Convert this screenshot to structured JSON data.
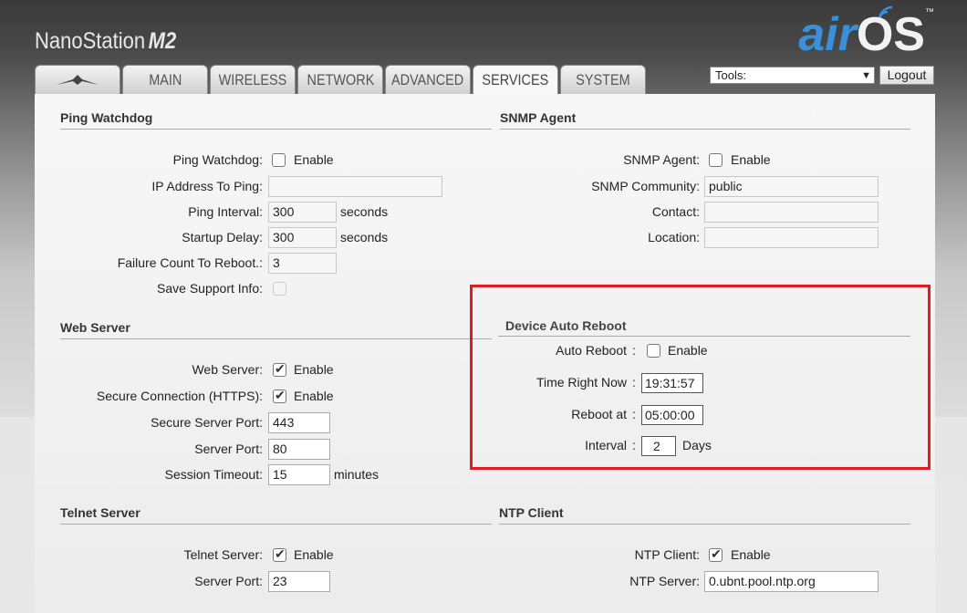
{
  "header": {
    "brand": "NanoStation",
    "brand_model": "M2",
    "logo_air": "air",
    "logo_os": "OS",
    "logo_tm": "™"
  },
  "tabs": [
    {
      "label": "",
      "icon": "ubiquiti-logo-icon"
    },
    {
      "label": "MAIN"
    },
    {
      "label": "WIRELESS"
    },
    {
      "label": "NETWORK"
    },
    {
      "label": "ADVANCED"
    },
    {
      "label": "SERVICES",
      "active": true
    },
    {
      "label": "SYSTEM"
    }
  ],
  "tools": {
    "label": "Tools:",
    "logout": "Logout"
  },
  "ping": {
    "title": "Ping Watchdog",
    "watchdog_label": "Ping Watchdog:",
    "enable": "Enable",
    "ip_label": "IP Address To Ping:",
    "ip_value": "",
    "interval_label": "Ping Interval:",
    "interval_value": "300",
    "interval_unit": "seconds",
    "startup_label": "Startup Delay:",
    "startup_value": "300",
    "startup_unit": "seconds",
    "failure_label": "Failure Count To Reboot.:",
    "failure_value": "3",
    "support_label": "Save Support Info:"
  },
  "snmp": {
    "title": "SNMP Agent",
    "agent_label": "SNMP Agent:",
    "enable": "Enable",
    "community_label": "SNMP Community:",
    "community_value": "public",
    "contact_label": "Contact:",
    "contact_value": "",
    "location_label": "Location:",
    "location_value": ""
  },
  "web": {
    "title": "Web Server",
    "server_label": "Web Server:",
    "enable": "Enable",
    "secure_label": "Secure Connection (HTTPS):",
    "secure_port_label": "Secure Server Port:",
    "secure_port_value": "443",
    "port_label": "Server Port:",
    "port_value": "80",
    "timeout_label": "Session Timeout:",
    "timeout_value": "15",
    "timeout_unit": "minutes"
  },
  "reboot": {
    "title": "Device Auto Reboot",
    "auto_label": "Auto Reboot",
    "colon": ":",
    "enable": "Enable",
    "now_label": "Time Right Now",
    "now_value": "19:31:57",
    "at_label": "Reboot at",
    "at_value": "05:00:00",
    "interval_label": "Interval",
    "interval_value": "2",
    "interval_unit": "Days"
  },
  "telnet": {
    "title": "Telnet Server",
    "server_label": "Telnet Server:",
    "enable": "Enable",
    "port_label": "Server Port:",
    "port_value": "23"
  },
  "ntp": {
    "title": "NTP Client",
    "client_label": "NTP Client:",
    "enable": "Enable",
    "server_label": "NTP Server:",
    "server_value": "0.ubnt.pool.ntp.org"
  },
  "colors": {
    "accent": "#3a8fd8",
    "highlight": "#e01b24"
  }
}
